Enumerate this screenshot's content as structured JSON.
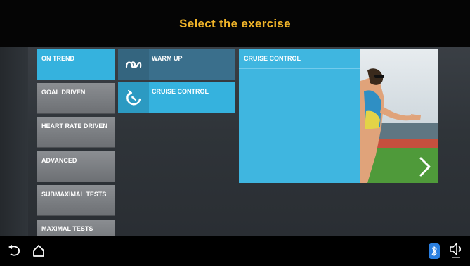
{
  "header": {
    "title": "Select the exercise"
  },
  "categories": [
    {
      "label": "ON TREND",
      "active": true
    },
    {
      "label": "GOAL DRIVEN",
      "active": false
    },
    {
      "label": "HEART RATE DRIVEN",
      "active": false
    },
    {
      "label": "ADVANCED",
      "active": false
    },
    {
      "label": "SUBMAXIMAL TESTS",
      "active": false
    },
    {
      "label": "MAXIMAL TESTS",
      "active": false
    }
  ],
  "exercises": [
    {
      "label": "WARM UP",
      "icon": "infinity-loop-icon"
    },
    {
      "label": "CRUISE CONTROL",
      "icon": "cruise-control-icon"
    }
  ],
  "detail": {
    "title": "CRUISE CONTROL"
  },
  "navbar": {
    "back_icon": "back-icon",
    "home_icon": "home-icon",
    "bluetooth_icon": "bluetooth-icon",
    "volume_icon": "volume-icon"
  },
  "colors": {
    "title": "#f0b429",
    "accent": "#35b2de",
    "button": "#7c7f83"
  }
}
